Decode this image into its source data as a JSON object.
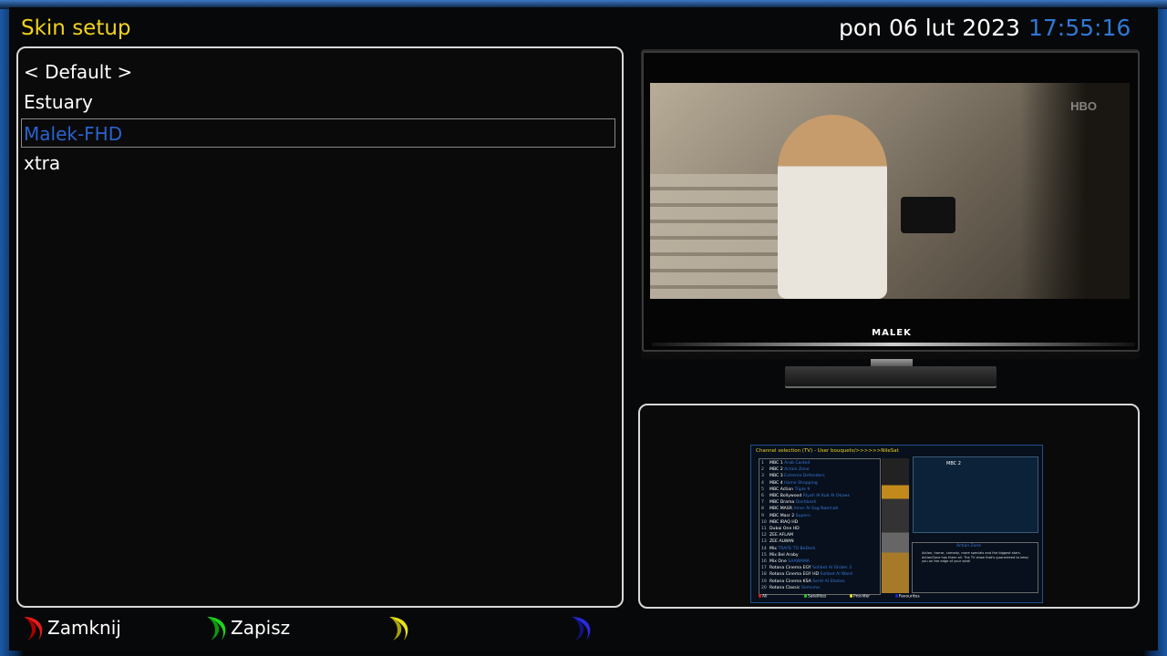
{
  "header": {
    "title": "Skin setup",
    "date": "pon 06 lut 2023",
    "time": "17:55:16"
  },
  "skin_list": {
    "items": [
      {
        "label": "< Default >",
        "selected": false
      },
      {
        "label": "Estuary",
        "selected": false
      },
      {
        "label": "Malek-FHD",
        "selected": true
      },
      {
        "label": "xtra",
        "selected": false
      }
    ]
  },
  "tv_preview": {
    "brand": "MALEK",
    "channel_watermark": "HBO"
  },
  "skin_preview": {
    "header": "Channel selection (TV) - User bouquets/>>>>>>NileSat",
    "channels": [
      {
        "num": "1",
        "name": "MBC 1",
        "event": "Arab Casted"
      },
      {
        "num": "2",
        "name": "MBC 2",
        "event": "Action Zone"
      },
      {
        "num": "3",
        "name": "MBC 3",
        "event": "Extreme Defenders"
      },
      {
        "num": "4",
        "name": "MBC 4",
        "event": "Home Shopping"
      },
      {
        "num": "5",
        "name": "MBC Action",
        "event": "Triple 9"
      },
      {
        "num": "6",
        "name": "MBC Bollywood",
        "event": "Riyah Al Kub Al Okaws"
      },
      {
        "num": "7",
        "name": "MBC Drama",
        "event": "Doshbash"
      },
      {
        "num": "8",
        "name": "MBC MASR",
        "event": "Amer Al Sag Naemah"
      },
      {
        "num": "9",
        "name": "MBC Masr 2",
        "event": "Supern"
      },
      {
        "num": "10",
        "name": "MBC IRAQ HD",
        "event": ""
      },
      {
        "num": "11",
        "name": "Dubai One HD",
        "event": ""
      },
      {
        "num": "12",
        "name": "ZEE AFLAM",
        "event": ""
      },
      {
        "num": "13",
        "name": "ZEE ALWAN",
        "event": ""
      },
      {
        "num": "14",
        "name": "Mix",
        "event": "TRAITs TO BeDark"
      },
      {
        "num": "15",
        "name": "Mix Bel Araby",
        "event": ""
      },
      {
        "num": "16",
        "name": "Mix One",
        "event": "SAAWAMA"
      },
      {
        "num": "17",
        "name": "Rotana Cinema EGY",
        "event": "Sohbet Al Ghaler 2"
      },
      {
        "num": "18",
        "name": "Rotana Cinema EGY HD",
        "event": "Sohbet Al Ward"
      },
      {
        "num": "19",
        "name": "Rotana Cinema KSA",
        "event": "Semt Al Shoton"
      },
      {
        "num": "20",
        "name": "Rotana Classic",
        "event": "Semsma"
      }
    ],
    "now_channel": "MBC 2",
    "info_title": "Action Zone",
    "info_text": "Action, horror, comedy, more specials and the biggest stars. ActionZone has them all. The TV show that's guaranteed to keep you on the edge of your seat!",
    "footer": {
      "all": "All",
      "satellites": "Satellites",
      "provider": "Provider",
      "favourites": "Favourites"
    }
  },
  "footer_keys": [
    {
      "color": "red",
      "hex": "#e11d1d",
      "label": "Zamknij"
    },
    {
      "color": "green",
      "hex": "#1ed41e",
      "label": "Zapisz"
    },
    {
      "color": "yellow",
      "hex": "#e8e21b",
      "label": ""
    },
    {
      "color": "blue",
      "hex": "#2222d8",
      "label": ""
    }
  ]
}
